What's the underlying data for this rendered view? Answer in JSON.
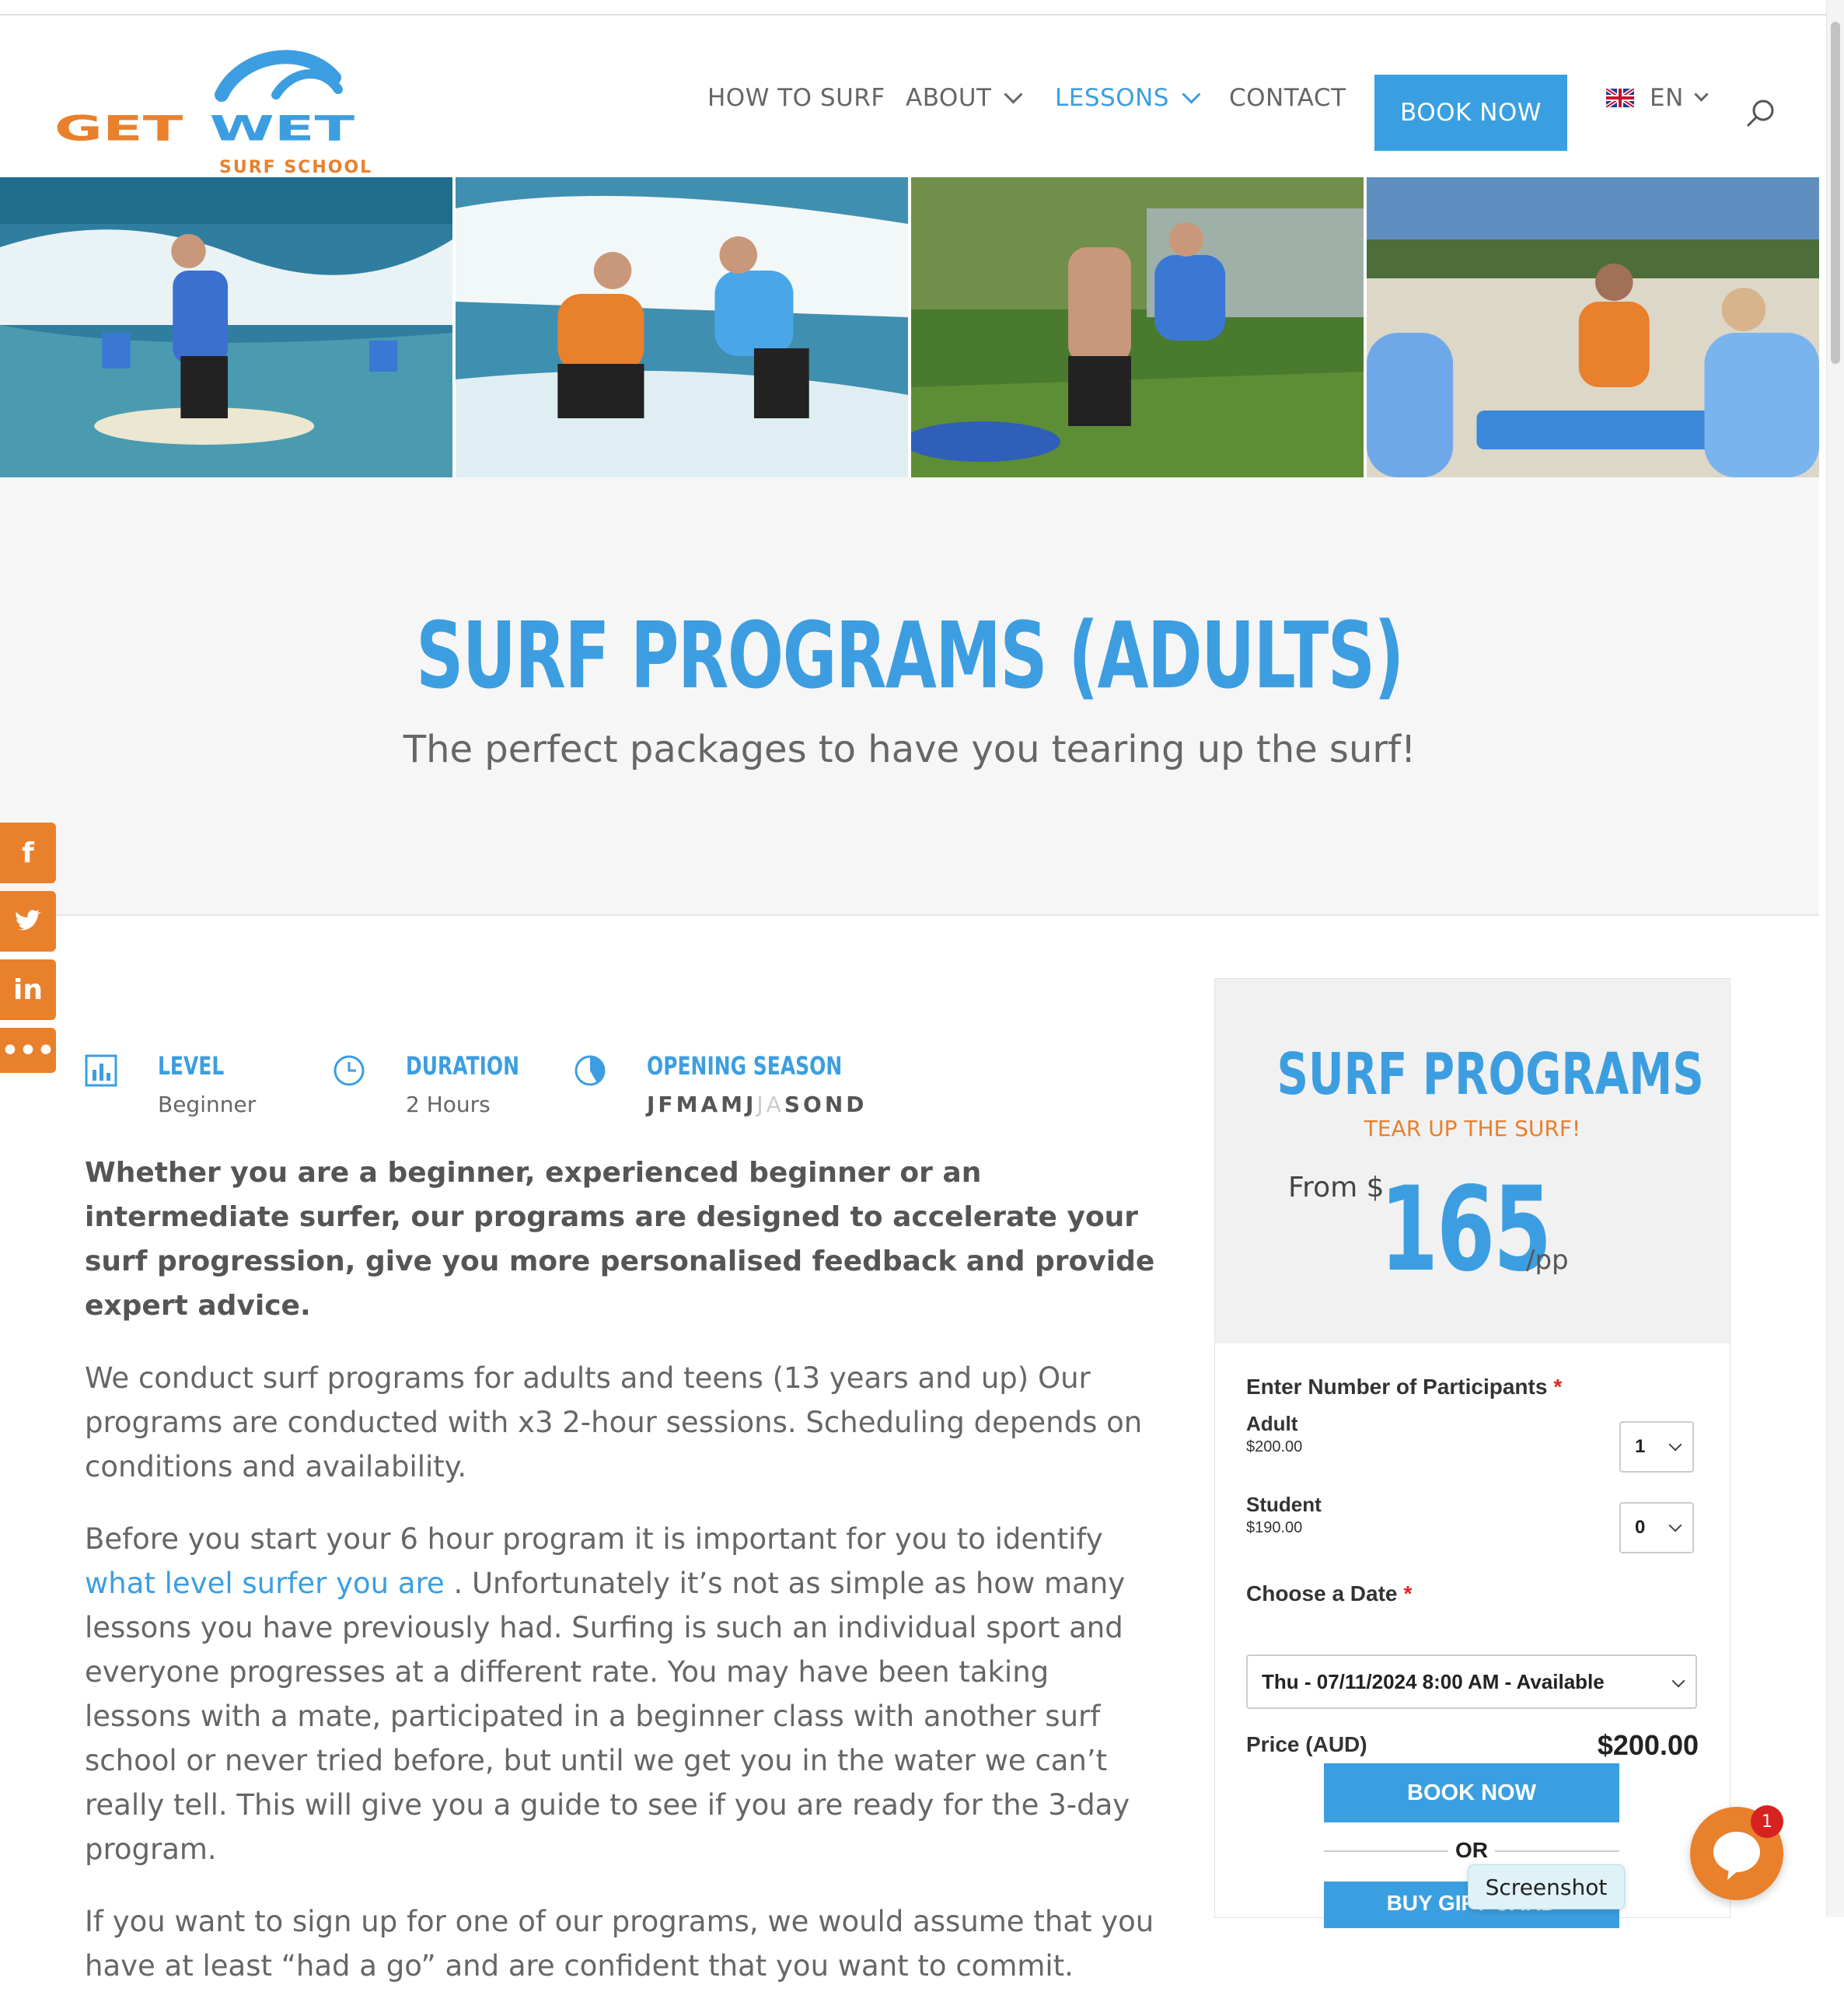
{
  "header": {
    "logo": {
      "text": "GETWET",
      "subtext": "SURF SCHOOL"
    },
    "nav": [
      {
        "label": "HOW TO SURF",
        "dropdown": false,
        "active": false
      },
      {
        "label": "ABOUT",
        "dropdown": true,
        "active": false
      },
      {
        "label": "LESSONS",
        "dropdown": true,
        "active": true
      },
      {
        "label": "CONTACT",
        "dropdown": false,
        "active": false
      }
    ],
    "book_now_label": "BOOK NOW",
    "language": "EN"
  },
  "hero": {
    "title": "SURF PROGRAMS (ADULTS)",
    "subtitle": "The perfect packages to have you tearing up the surf!"
  },
  "social": [
    "f",
    "twitter",
    "in",
    "•••"
  ],
  "details": {
    "level": {
      "label": "LEVEL",
      "value": "Beginner"
    },
    "duration": {
      "label": "DURATION",
      "value": "2 Hours"
    },
    "season": {
      "label": "OPENING SEASON",
      "months": [
        {
          "m": "J",
          "open": true
        },
        {
          "m": "F",
          "open": true
        },
        {
          "m": "M",
          "open": true
        },
        {
          "m": "A",
          "open": true
        },
        {
          "m": "M",
          "open": true
        },
        {
          "m": "J",
          "open": true
        },
        {
          "m": "J",
          "open": false
        },
        {
          "m": "A",
          "open": false
        },
        {
          "m": "S",
          "open": true
        },
        {
          "m": "O",
          "open": true
        },
        {
          "m": "N",
          "open": true
        },
        {
          "m": "D",
          "open": true
        }
      ]
    }
  },
  "content": {
    "lead": "Whether you are a beginner, experienced beginner or an intermediate surfer, our programs are designed to accelerate your surf progression, give you more personalised feedback and provide expert advice.",
    "p1": "We conduct surf programs for adults and teens (13 years and up) Our programs are conducted with x3 2-hour sessions. Scheduling depends on conditions and availability.",
    "p2_before": "Before you start your 6 hour program it is important for you to identify ",
    "p2_link": "what level surfer you are",
    "p2_after": " . Unfortunately it’s not as simple as how many lessons you have previously had. Surfing is such an individual sport and everyone progresses at a different rate.  You may have been taking lessons with a mate, participated in a beginner class with another surf school or never tried before, but until we get you in the water we can’t really tell. This will give you a guide to see if you are ready for the 3-day program.",
    "p3": "If you want to sign up for one of our programs, we would assume that you have at least “had a go” and are confident that you want to commit."
  },
  "card": {
    "title": "SURF PROGRAMS",
    "tagline": "TEAR UP THE SURF!",
    "from_label": "From $",
    "price": "165",
    "unit": "/pp",
    "participants_label": "Enter Number of Participants",
    "required": "*",
    "adult": {
      "label": "Adult",
      "price": "$200.00",
      "qty": "1"
    },
    "student": {
      "label": "Student",
      "price": "$190.00",
      "qty": "0"
    },
    "date_label": "Choose a Date",
    "date_value": "Thu - 07/11/2024 8:00 AM - Available",
    "price_label": "Price (AUD)",
    "price_value": "$200.00",
    "book_label": "BOOK NOW",
    "or_label": "OR",
    "gift_label": "BUY GIFT CARD"
  },
  "overlay": {
    "tooltip": "Screenshot",
    "chat_badge": "1"
  },
  "colors": {
    "accent_blue": "#3c9ee0",
    "accent_orange": "#e9802c"
  }
}
